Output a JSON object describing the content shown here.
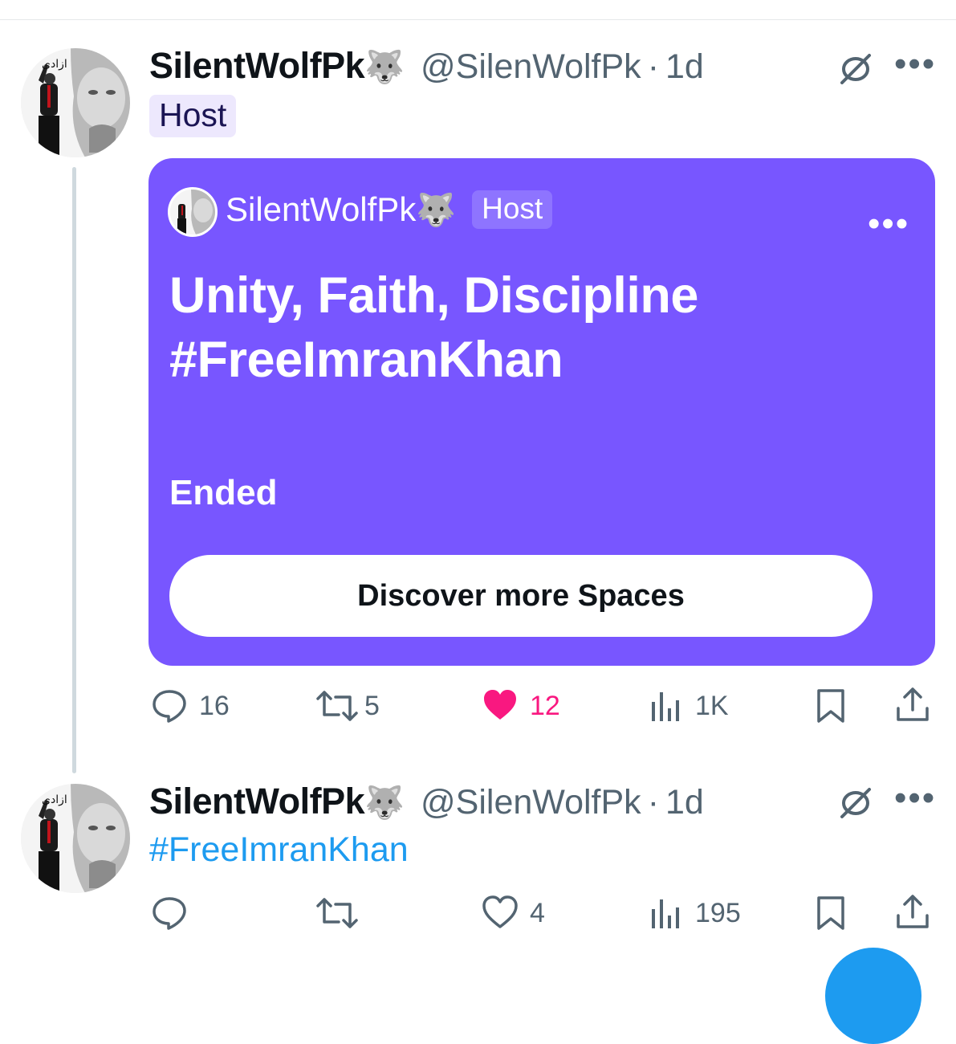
{
  "tweet1": {
    "display_name": "SilentWolfPk",
    "emoji": "🐺",
    "handle": "@SilenWolfPk",
    "separator": "·",
    "time": "1d",
    "badge": "Host",
    "space": {
      "host_name": "SilentWolfPk",
      "host_emoji": "🐺",
      "host_badge": "Host",
      "title_line1": "Unity, Faith, Discipline",
      "title_line2": "#FreeImranKhan",
      "status": "Ended",
      "cta": "Discover more Spaces",
      "color": "#7856ff"
    },
    "actions": {
      "replies": "16",
      "reposts": "5",
      "likes": "12",
      "views": "1K"
    }
  },
  "tweet2": {
    "display_name": "SilentWolfPk",
    "emoji": "🐺",
    "handle": "@SilenWolfPk",
    "separator": "·",
    "time": "1d",
    "text": "#FreeImranKhan",
    "actions": {
      "likes": "4",
      "views": "195"
    }
  },
  "colors": {
    "accent": "#1d9bf0",
    "like": "#f91880",
    "muted": "#536471"
  },
  "icons": [
    "spaces-icon",
    "more-icon",
    "reply-icon",
    "repost-icon",
    "like-icon",
    "views-icon",
    "bookmark-icon",
    "share-icon"
  ]
}
